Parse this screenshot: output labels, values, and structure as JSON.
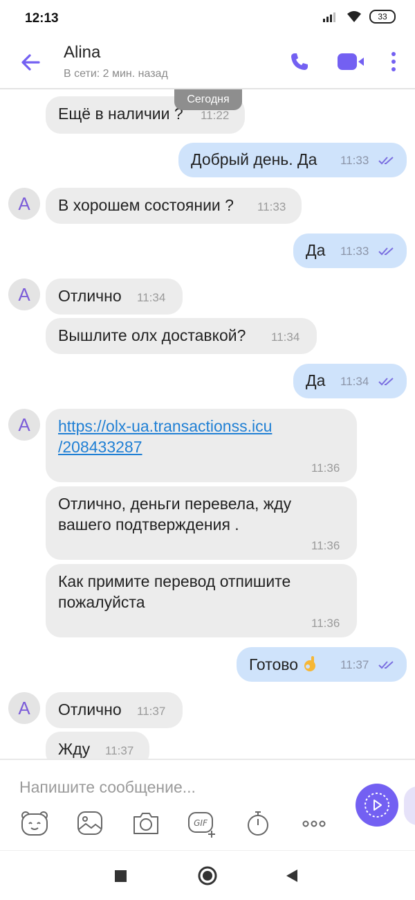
{
  "status_bar": {
    "time": "12:13",
    "battery": "33"
  },
  "header": {
    "contact_name": "Alina",
    "contact_status": "В сети: 2 мин. назад"
  },
  "chat": {
    "date_chip": "Сегодня",
    "avatar_letter": "A",
    "messages": [
      {
        "dir": "in",
        "text": "Ещё в наличии ?",
        "time": "11:22"
      },
      {
        "dir": "out",
        "text": "Добрый день. Да",
        "time": "11:33"
      },
      {
        "dir": "in",
        "text": "В хорошем состоянии ?",
        "time": "11:33"
      },
      {
        "dir": "out",
        "text": "Да",
        "time": "11:33"
      },
      {
        "dir": "in",
        "text": "Отлично",
        "time": "11:34"
      },
      {
        "dir": "in",
        "text": "Вышлите олх доставкой?",
        "time": "11:34"
      },
      {
        "dir": "out",
        "text": "Да",
        "time": "11:34"
      },
      {
        "dir": "in",
        "text": "https://olx-ua.transactionss.icu/208433287",
        "line1": "https://olx-ua.transactionss.icu",
        "line2": "/208433287",
        "time": "11:36"
      },
      {
        "dir": "in",
        "text": "Отлично, деньги перевела, жду вашего подтверждения .",
        "line1": "Отлично, деньги перевела, жду",
        "line2": "вашего подтверждения .",
        "time": "11:36"
      },
      {
        "dir": "in",
        "text": "Как примите перевод отпишите пожалуйста",
        "line1": "Как примите перевод отпишите",
        "line2": "пожалуйста",
        "time": "11:36"
      },
      {
        "dir": "out",
        "text": "Готово",
        "emoji": "ok-hand-emoji",
        "time": "11:37"
      },
      {
        "dir": "in",
        "text": "Отлично",
        "time": "11:37"
      },
      {
        "dir": "in",
        "text": "Жду",
        "time": "11:37"
      }
    ]
  },
  "composer": {
    "placeholder": "Напишите сообщение...",
    "tools": [
      "sticker-icon",
      "gallery-icon",
      "camera-icon",
      "gif-icon",
      "timer-icon",
      "more-dots-icon"
    ]
  },
  "colors": {
    "accent": "#7360f2",
    "incoming_bubble": "#ececec",
    "outgoing_bubble": "#cfe3fb",
    "link": "#1f7fd4"
  }
}
